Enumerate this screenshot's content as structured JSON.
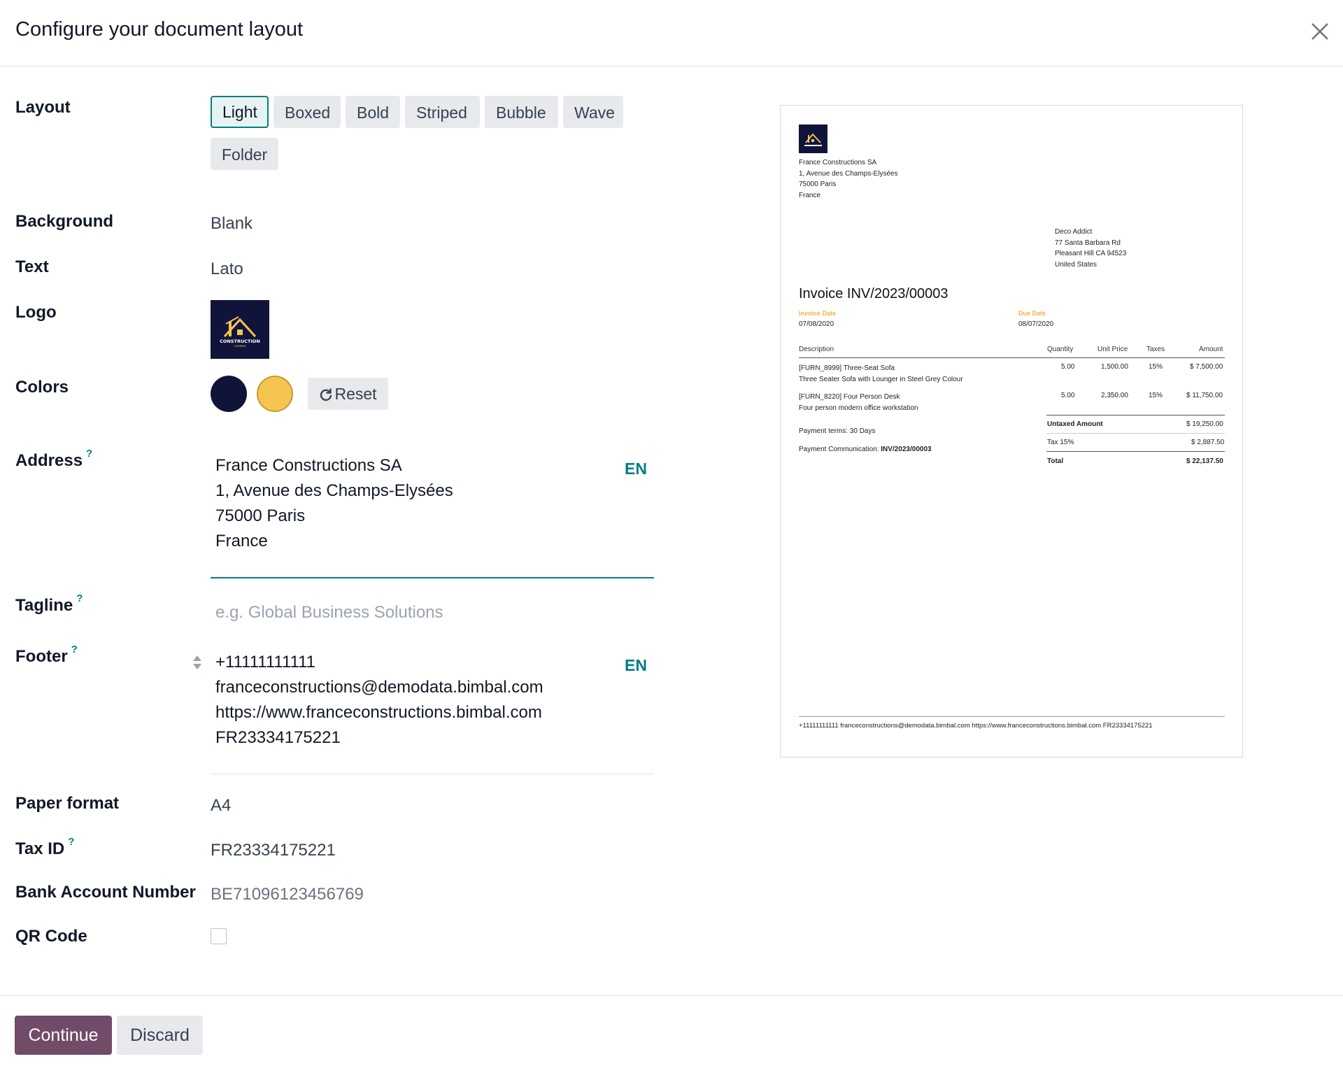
{
  "dialog": {
    "title": "Configure your document layout"
  },
  "labels": {
    "layout": "Layout",
    "background": "Background",
    "text": "Text",
    "logo": "Logo",
    "colors": "Colors",
    "address": "Address",
    "tagline": "Tagline",
    "footer": "Footer",
    "paper_format": "Paper format",
    "tax_id": "Tax ID",
    "bank_account": "Bank Account Number",
    "qr_code": "QR Code",
    "help_marker": "?"
  },
  "layout_options": [
    "Light",
    "Boxed",
    "Bold",
    "Striped",
    "Bubble",
    "Wave",
    "Folder"
  ],
  "layout_selected": "Light",
  "background_value": "Blank",
  "text_value": "Lato",
  "colors": {
    "primary": "#11143a",
    "secondary": "#f5c451",
    "reset_label": "Reset"
  },
  "address": {
    "lines": [
      "France Constructions SA",
      "1, Avenue des Champs-Elysées",
      "75000 Paris",
      "France"
    ],
    "lang": "EN"
  },
  "tagline": {
    "placeholder": "e.g. Global Business Solutions",
    "value": ""
  },
  "footer": {
    "lines": [
      "+11111111111",
      "franceconstructions@demodata.bimbal.com",
      "https://www.franceconstructions.bimbal.com",
      "FR23334175221"
    ],
    "lang": "EN"
  },
  "paper_format_value": "A4",
  "tax_id_value": "FR23334175221",
  "bank_account_value": "BE71096123456769",
  "qr_code_checked": false,
  "actions": {
    "continue_label": "Continue",
    "discard_label": "Discard"
  },
  "preview": {
    "company_lines": [
      "France Constructions SA",
      "1, Avenue des Champs-Elysées",
      "75000 Paris",
      "France"
    ],
    "customer_lines": [
      "Deco Addict",
      "77 Santa Barbara Rd",
      "Pleasant Hill CA 94523",
      "United States"
    ],
    "invoice_title": "Invoice INV/2023/00003",
    "invoice_date_label": "Invoice Date",
    "invoice_date": "07/08/2020",
    "due_date_label": "Due Date",
    "due_date": "08/07/2020",
    "columns": [
      "Description",
      "Quantity",
      "Unit Price",
      "Taxes",
      "Amount"
    ],
    "lines": [
      {
        "name": "[FURN_8999] Three-Seat Sofa",
        "desc": "Three Seater Sofa with Lounger in Steel Grey Colour",
        "qty": "5.00",
        "price": "1,500.00",
        "tax": "15%",
        "amount": "$ 7,500.00"
      },
      {
        "name": "[FURN_8220] Four Person Desk",
        "desc": "Four person modern office workstation",
        "qty": "5.00",
        "price": "2,350.00",
        "tax": "15%",
        "amount": "$ 11,750.00"
      }
    ],
    "payment_terms": "Payment terms: 30 Days",
    "payment_comm_label": "Payment Communication:",
    "payment_comm_value": "INV/2023/00003",
    "untaxed_label": "Untaxed Amount",
    "untaxed_value": "$ 19,250.00",
    "tax_label": "Tax 15%",
    "tax_value": "$ 2,887.50",
    "total_label": "Total",
    "total_value": "$ 22,137.50",
    "footer_text": "+11111111111 franceconstructions@demodata.bimbal.com https://www.franceconstructions.bimbal.com FR23334175221"
  }
}
